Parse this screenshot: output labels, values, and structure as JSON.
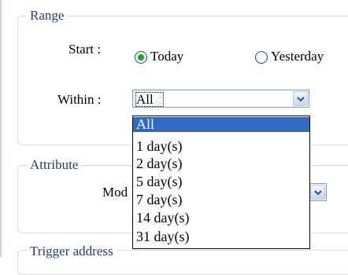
{
  "range": {
    "title": "Range",
    "start_label": "Start :",
    "start_options": [
      {
        "label": "Today",
        "checked": true
      },
      {
        "label": "Yesterday",
        "checked": false
      }
    ],
    "within_label": "Within :",
    "within_value": "All",
    "within_options": [
      "All",
      "1 day(s)",
      "2 day(s)",
      "5 day(s)",
      "7 day(s)",
      "14 day(s)",
      "31 day(s)"
    ],
    "within_selected_index": 0
  },
  "attribute": {
    "title": "Attribute",
    "mode_label": "Mod"
  },
  "trigger": {
    "title": "Trigger address"
  },
  "colors": {
    "group_title": "#21406e",
    "selection": "#316ac5",
    "radio_dot": "#21a121"
  },
  "icons": {
    "dropdown": "chevron-down-icon",
    "radio": "radio-button-icon"
  }
}
